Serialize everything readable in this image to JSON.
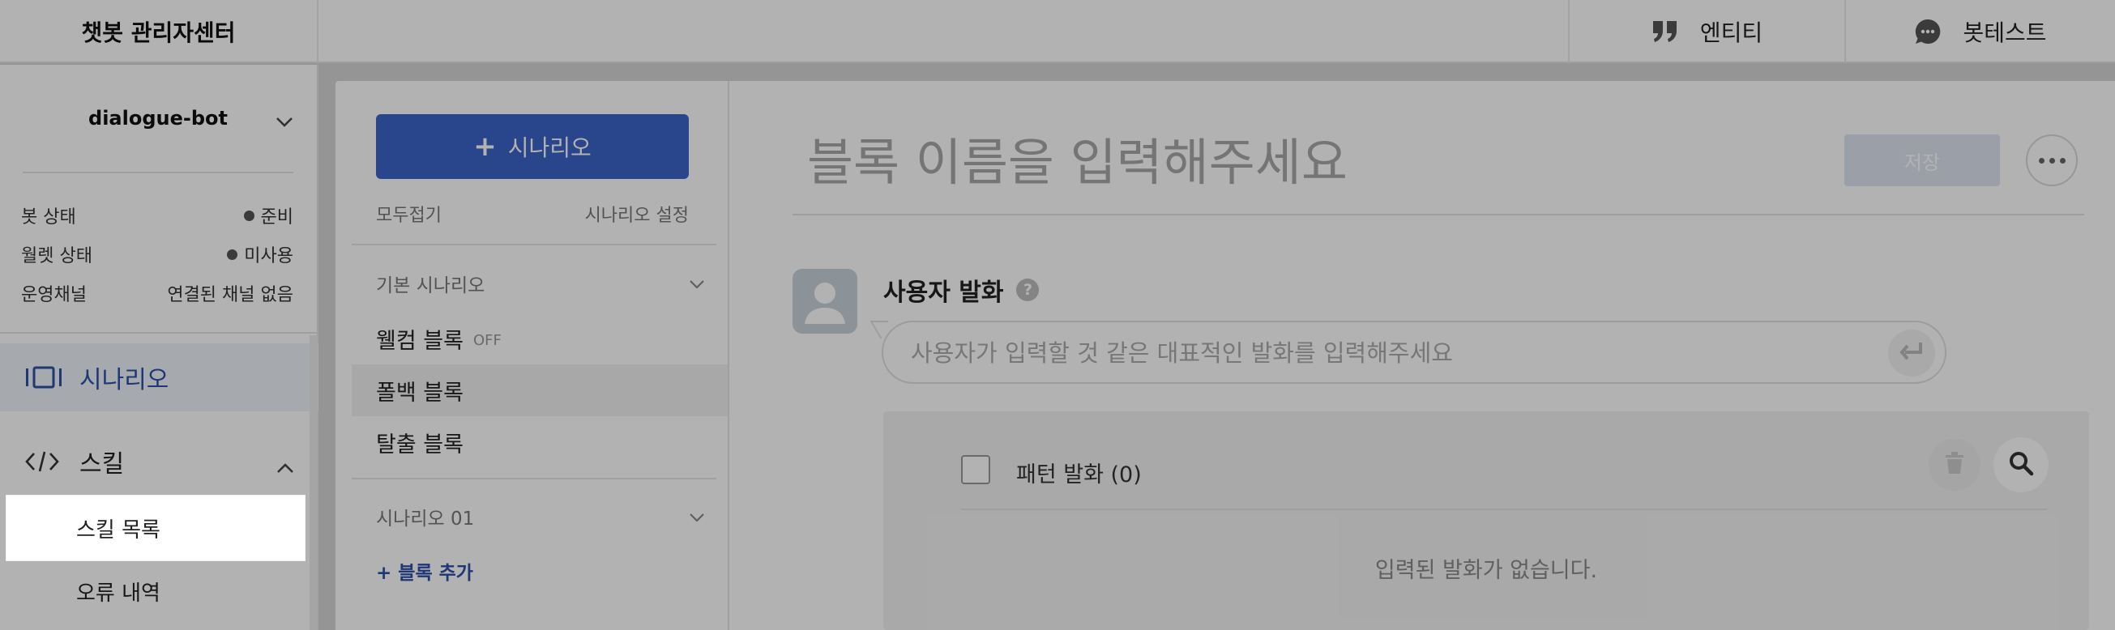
{
  "app": {
    "title": "챗봇 관리자센터"
  },
  "topnav": {
    "entity_label": "엔티티",
    "entity_icon": "quote-icon",
    "bottest_label": "봇테스트",
    "bottest_icon": "chat-bubble-icon"
  },
  "sidebar": {
    "bot_name": "dialogue-bot",
    "status": [
      {
        "label": "봇 상태",
        "value": "준비"
      },
      {
        "label": "월렛 상태",
        "value": "미사용"
      },
      {
        "label": "운영채널",
        "value": "연결된 채널 없음"
      }
    ],
    "menu_scenario": "시나리오",
    "menu_skill": "스킬",
    "skill_sub": [
      "스킬 목록",
      "오류 내역"
    ]
  },
  "scenario_panel": {
    "add_button": "시나리오",
    "collapse_all": "모두접기",
    "settings": "시나리오 설정",
    "group1_title": "기본 시나리오",
    "blocks": [
      {
        "label": "웰컴 블록",
        "tag": "OFF"
      },
      {
        "label": "폴백 블록"
      },
      {
        "label": "탈출 블록"
      }
    ],
    "group2_title": "시나리오 01",
    "add_block": "+ 블록 추가"
  },
  "editor": {
    "title_placeholder": "블록 이름을 입력해주세요",
    "save_label": "저장",
    "utterance_label": "사용자 발화",
    "utterance_placeholder": "사용자가 입력할 것 같은 대표적인 발화를 입력해주세요",
    "pattern_label": "패턴 발화 (0)",
    "empty_text": "입력된 발화가 없습니다."
  },
  "colors": {
    "accent": "#3b63c9",
    "overlay": "rgba(0,0,0,0.30)"
  }
}
